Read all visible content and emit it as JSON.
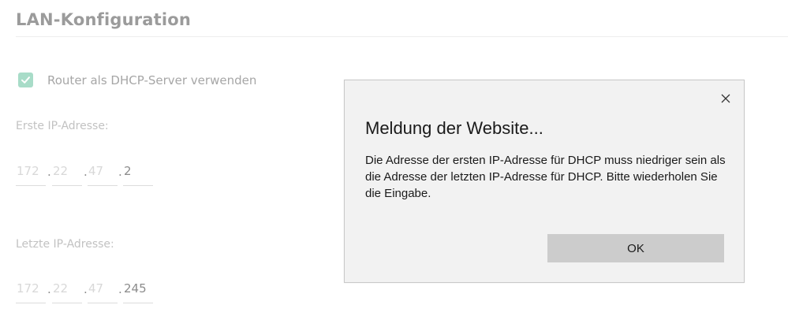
{
  "page": {
    "title": "LAN-Konfiguration"
  },
  "dhcp": {
    "checkbox_checked": true,
    "label": "Router als DHCP-Server verwenden",
    "accent_color": "#a8dcc8"
  },
  "first_ip": {
    "label": "Erste IP-Adresse:",
    "octets": [
      "172",
      "22",
      "47",
      "2"
    ]
  },
  "last_ip": {
    "label": "Letzte IP-Adresse:",
    "octets": [
      "172",
      "22",
      "47",
      "245"
    ]
  },
  "dot": ".",
  "dialog": {
    "title": "Meldung der Website...",
    "message": "Die Adresse der ersten IP-Adresse für DHCP muss niedriger sein als die Adresse der letzten IP-Adresse für DHCP. Bitte wiederholen Sie die Eingabe.",
    "ok_label": "OK",
    "close_icon": "close-icon"
  }
}
